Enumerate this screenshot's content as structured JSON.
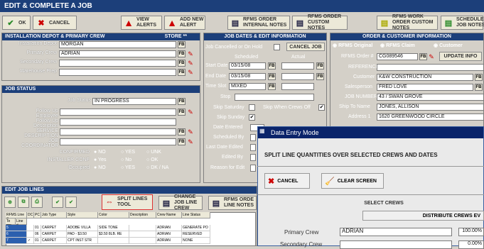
{
  "title": "EDIT & COMPLETE A JOB",
  "toolbar": {
    "ok": "OK",
    "cancel": "CANCEL",
    "view_alerts": "VIEW ALERTS",
    "add_alert": "ADD NEW ALERT",
    "rfms_internal": "RFMS ORDER INTERNAL NOTES",
    "rfms_customer": "RFMS ORDER CUSTOM NOTES",
    "rfms_workorder": "RFMS WORK ORDER CUSTOM NOTES",
    "scheduler": "SCHEDULER JOB NOTES"
  },
  "install": {
    "header": "INSTALLATION DEPOT & PRIMARY CREW",
    "store": "Store **",
    "depot_label": "Installation Depot",
    "depot_value": "MORGAN",
    "crew_label": "Primary Crew",
    "crew_value": "ADRIAN",
    "sec_label": "Secondary Crew",
    "sec_value": "",
    "wh_label": "Warehouse Prep",
    "wh_value": ""
  },
  "status": {
    "header": "JOB STATUS",
    "job_status_label": "Job Status",
    "job_status_value": "IN PROGRESS",
    "follow_emp": "Follow Up Employee",
    "follow_desc": "Follow Up Description",
    "service_desc": "SERVICE DESCRIPTION",
    "coordinator": "JOB COORDINATOR",
    "confirmed": "CONFIRMED",
    "installer_conf": "INSTALLER CONF",
    "occupied": "Occupied",
    "opt_no": "NO",
    "opt_yes": "YES",
    "opt_unk": "UNK",
    "opt_yes2": "Yes",
    "opt_no2": "No",
    "opt_ok": "OK",
    "opt_no3": "NO",
    "opt_yes3": "YES",
    "opt_dk": "DK / NA"
  },
  "dates": {
    "header": "JOB DATES & EDIT INFORMATION",
    "cancelled": "Job Cancelled or On Hold",
    "cancel_job": "CANCEL JOB",
    "scheduled": "Scheduled",
    "actual": "Actual",
    "start_label": "Start Date",
    "start_value": "03/15/08",
    "end_label": "End Date",
    "end_value": "03/15/08",
    "time_label": "Time Slot",
    "time_value": "MIXED",
    "stop": "Stop",
    "skip_sat": "Skip Saturday",
    "skip_crews": "Skip When Crews Off",
    "skip_sun": "Skip Sunday",
    "date_entered": "Date Entered",
    "sched_by": "Scheduled By",
    "last_edited": "Last Date Edited",
    "edited_by": "Edited By",
    "reason": "Reason for Edit"
  },
  "order": {
    "header": "ORDER & CUSTOMER INFORMATION",
    "rfms_original": "RFMS Original",
    "rfms_claim": "RFMS Claim",
    "customer_tab": "Customer",
    "order_label": "RFMS Order #",
    "order_value": "CG089546",
    "update": "UPDATE INFO",
    "reference": "REFERENCE",
    "customer_label": "Customer",
    "customer_value": "K&W CONSTRUCTION",
    "salesperson_label": "Salesperson",
    "salesperson_value": "FRED LOVE",
    "jobnum_label": "JOB NUMBER",
    "jobnum_value": "43 / SWAN GROVE",
    "shipto_label": "Ship To Name",
    "shipto_value": "JONES, ALLISON",
    "addr_label": "Address 1",
    "addr_value": "1620 GREENWOOD CIRCLE"
  },
  "lines": {
    "header": "EDIT JOB LINES",
    "split": "SPLIT LINES TOOL",
    "change": "CHANGE JOB LINE CREW",
    "rfms_notes": "RFMS ORDE LINE NOTES",
    "columns": [
      "RFMS Line #",
      "DC",
      "PC",
      "Job Type",
      "Style",
      "Color",
      "Description",
      "Crew Name",
      "Line Status"
    ],
    "subcols": [
      "Te mp",
      "Line #"
    ],
    "rows": [
      [
        "5",
        "",
        "01",
        "CARPET",
        "ADOBE VILLA",
        "SIDE TONE",
        "",
        "ADRIAN",
        "GENERATE PO"
      ],
      [
        "6",
        "",
        "06",
        "CARPET",
        "PAD - $3.50",
        "$3.50 8LB. RE",
        "",
        "ADRIAN",
        "RESERVED"
      ],
      [
        "7",
        "✓",
        "01",
        "CARPET",
        "CPT INST STR",
        "",
        "",
        "ADRIAN",
        "NONE"
      ]
    ]
  },
  "dialog": {
    "title": "Data Entry Mode",
    "heading": "SPLIT LINE QUANTITIES OVER SELECTED CREWS AND DATES",
    "cancel": "CANCEL",
    "clear": "CLEAR SCREEN",
    "select_crews": "SELECT CREWS",
    "distribute": "DISTRIBUTE CREWS EV",
    "primary_label": "Primary Crew",
    "primary_value": "ADRIAN",
    "primary_pct": "100.00%",
    "secondary_label": "Secondary Crew",
    "secondary_pct": "0.00%"
  }
}
